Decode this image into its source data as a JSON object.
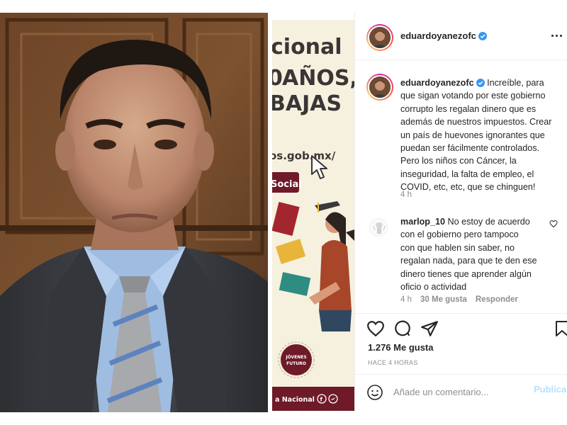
{
  "poster": {
    "headline": "cional",
    "line2": "AÑOS,",
    "line2_digit": "0",
    "line3": "BAJAS",
    "url": "os.gob.mx/",
    "section_label": "Social",
    "logo_line1": "JÓVENES",
    "logo_line2": "FUTURO",
    "footer": "a Nacional",
    "colors": {
      "background": "#f6f0df",
      "wine": "#6e1a29",
      "text": "#3a3636"
    }
  },
  "post": {
    "header": {
      "username": "eduardoyanezofc",
      "verified": true,
      "more_icon": "more-horizontal-icon"
    },
    "caption": {
      "username": "eduardoyanezofc",
      "lines": [
        "Increíble, para",
        "que sigan votando por este gobierno",
        "corrupto les regalan dinero que es",
        "además de nuestros impuestos. Crear",
        "un país de huevones ignorantes que",
        "puedan ser fácilmente controlados.",
        "Pero los niños con Cáncer, la",
        "inseguridad, la falta de empleo, el",
        "COVID, etc, etc, que se chinguen!"
      ],
      "time": "4 h"
    },
    "reply": {
      "username": "marlop_10",
      "lines": [
        "No estoy de acuerdo",
        "con el gobierno pero tampoco",
        "con que hablen sin saber, no",
        "regalan nada, para que te den ese",
        "dinero tienes que aprender algún",
        "oficio o actividad"
      ],
      "time": "4 h",
      "likes": "30 Me gusta",
      "reply_label": "Responder"
    },
    "actions": [
      "heart-icon",
      "comment-icon",
      "share-icon",
      "bookmark-icon"
    ],
    "likes": "1.276 Me gusta",
    "time_ago": "HACE 4 HORAS",
    "comment_box": {
      "placeholder": "Añade un comentario...",
      "publish_label": "Publicar"
    }
  }
}
